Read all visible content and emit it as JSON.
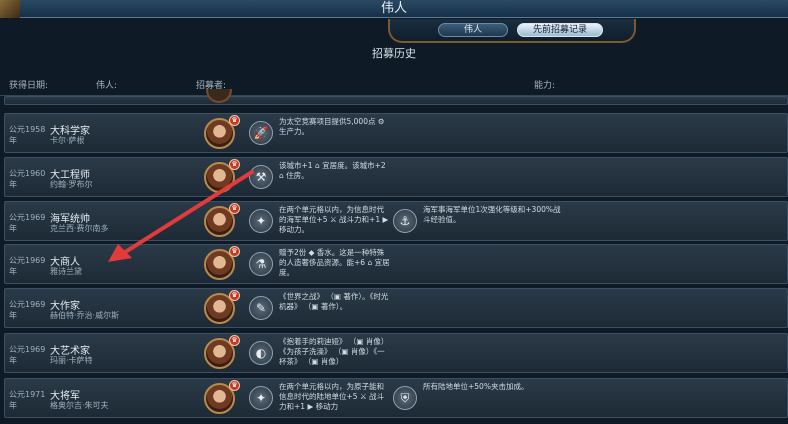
{
  "window": {
    "title": "伟人"
  },
  "tabs": [
    {
      "label": "伟人",
      "active": false
    },
    {
      "label": "先前招募记录",
      "active": true
    }
  ],
  "section_title": "招募历史",
  "columns": {
    "date": "获得日期:",
    "person": "伟人:",
    "recruiter": "招募者:",
    "ability": "能力:"
  },
  "rows": [
    {
      "date": "公元1958年",
      "name": "大科学家",
      "person": "卡尔·萨根",
      "icon": "rocket-icon",
      "ability": "为太空竞赛项目提供5,000点 ⚙ 生产力。",
      "ability2": ""
    },
    {
      "date": "公元1960年",
      "name": "大工程师",
      "person": "约翰·罗布尔",
      "icon": "tools-icon",
      "ability": "该城市+1 ⌂ 宜居度。该城市+2 ⌂ 住房。",
      "ability2": ""
    },
    {
      "date": "公元1969年",
      "name": "海军统帅",
      "person": "克兰西·费尔南多",
      "icon": "compass-icon",
      "ability": "在两个单元格以内，为信息时代的海军单位+5 ⚔ 战斗力和+1 ▶ 移动力。",
      "ability2": "海军事海军单位1次强化等级和+300%战斗经验值。",
      "icon2": "ship-icon"
    },
    {
      "date": "公元1969年",
      "name": "大商人",
      "person": "雅诗兰黛",
      "icon": "perfume-icon",
      "ability": "赠予2份 ◆ 香水。这是一种特殊的人造奢侈品资源。能+6 ⌂ 宜居度。",
      "ability2": ""
    },
    {
      "date": "公元1969年",
      "name": "大作家",
      "person": "赫伯特·乔治·威尔斯",
      "icon": "quill-icon",
      "ability": "《世界之战》 （▣ 著作）。《时光机器》 （▣ 著作）。",
      "ability2": ""
    },
    {
      "date": "公元1969年",
      "name": "大艺术家",
      "person": "玛丽·卡萨特",
      "icon": "palette-icon",
      "ability": "《抱着手的莉迪娅》 （▣ 肖像）《为孩子洗澡》 （▣ 肖像）《一杯茶》 （▣ 肖像）",
      "ability2": ""
    },
    {
      "date": "公元1971年",
      "name": "大将军",
      "person": "格奥尔吉·朱可夫",
      "icon": "compass-icon",
      "ability": "在两个单元格以内，为原子能和信息时代的陆地单位+5 ⚔ 战斗力和+1 ▶ 移动力",
      "ability2": "所有陆地单位+50%夹击加成。",
      "icon2": "shield-icon"
    }
  ],
  "colors": {
    "accent": "#c23a2a",
    "frame": "#7a5a2e"
  }
}
